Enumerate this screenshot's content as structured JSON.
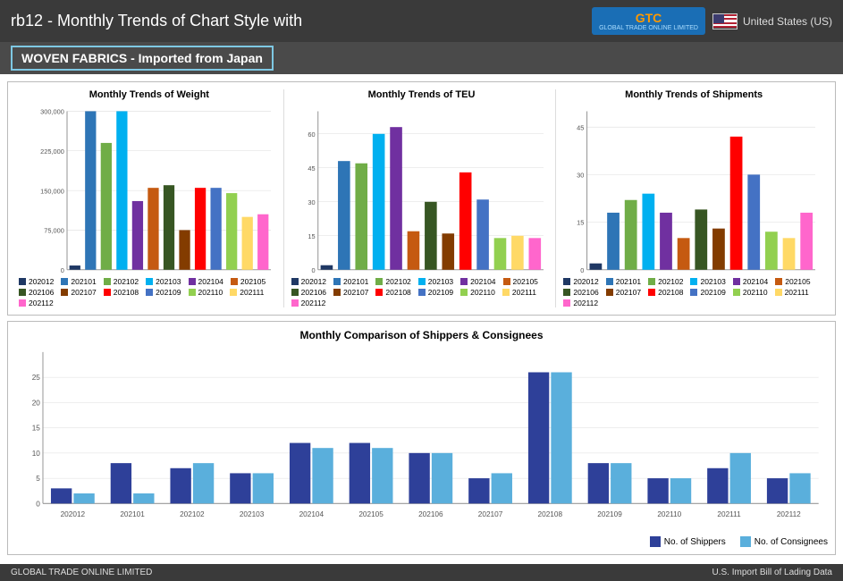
{
  "header": {
    "title": "rb12 - Monthly Trends of Chart Style with",
    "subtitle": "WOVEN FABRICS - Imported from Japan",
    "country": "United States (US)"
  },
  "footer": {
    "left": "GLOBAL TRADE ONLINE LIMITED",
    "right": "U.S. Import Bill of Lading Data"
  },
  "legends": {
    "periods": [
      {
        "id": "202012",
        "color": "#1f3864"
      },
      {
        "id": "202101",
        "color": "#2e75b6"
      },
      {
        "id": "202102",
        "color": "#70ad47"
      },
      {
        "id": "202103",
        "color": "#00b0f0"
      },
      {
        "id": "202104",
        "color": "#7030a0"
      },
      {
        "id": "202105",
        "color": "#c55a11"
      },
      {
        "id": "202106",
        "color": "#375623"
      },
      {
        "id": "202107",
        "color": "#833c00"
      },
      {
        "id": "202108",
        "color": "#ff0000"
      },
      {
        "id": "202109",
        "color": "#4472c4"
      },
      {
        "id": "202110",
        "color": "#92d050"
      },
      {
        "id": "202111",
        "color": "#ffd966"
      },
      {
        "id": "202112",
        "color": "#ff66cc"
      }
    ]
  },
  "weightChart": {
    "title": "Monthly Trends of Weight",
    "yLabels": [
      "300,000",
      "225,000",
      "150,000",
      "75,000",
      "0"
    ],
    "bars": [
      {
        "period": "202012",
        "value": 8000,
        "color": "#1f3864"
      },
      {
        "period": "202101",
        "value": 320000,
        "color": "#2e75b6"
      },
      {
        "period": "202102",
        "value": 240000,
        "color": "#70ad47"
      },
      {
        "period": "202103",
        "value": 320000,
        "color": "#00b0f0"
      },
      {
        "period": "202104",
        "value": 130000,
        "color": "#7030a0"
      },
      {
        "period": "202105",
        "value": 155000,
        "color": "#c55a11"
      },
      {
        "period": "202106",
        "value": 160000,
        "color": "#375623"
      },
      {
        "period": "202107",
        "value": 75000,
        "color": "#833c00"
      },
      {
        "period": "202108",
        "value": 155000,
        "color": "#ff0000"
      },
      {
        "period": "202109",
        "value": 155000,
        "color": "#4472c4"
      },
      {
        "period": "202110",
        "value": 145000,
        "color": "#92d050"
      },
      {
        "period": "202111",
        "value": 100000,
        "color": "#ffd966"
      },
      {
        "period": "202112",
        "value": 105000,
        "color": "#ff66cc"
      }
    ],
    "maxVal": 340000
  },
  "teuChart": {
    "title": "Monthly Trends of TEU",
    "yLabels": [
      "60",
      "45",
      "30",
      "15",
      "0"
    ],
    "bars": [
      {
        "period": "202012",
        "value": 2,
        "color": "#1f3864"
      },
      {
        "period": "202101",
        "value": 48,
        "color": "#2e75b6"
      },
      {
        "period": "202102",
        "value": 47,
        "color": "#70ad47"
      },
      {
        "period": "202103",
        "value": 60,
        "color": "#00b0f0"
      },
      {
        "period": "202104",
        "value": 63,
        "color": "#7030a0"
      },
      {
        "period": "202105",
        "value": 17,
        "color": "#c55a11"
      },
      {
        "period": "202106",
        "value": 30,
        "color": "#375623"
      },
      {
        "period": "202107",
        "value": 16,
        "color": "#833c00"
      },
      {
        "period": "202108",
        "value": 43,
        "color": "#ff0000"
      },
      {
        "period": "202109",
        "value": 31,
        "color": "#4472c4"
      },
      {
        "period": "202110",
        "value": 14,
        "color": "#92d050"
      },
      {
        "period": "202111",
        "value": 15,
        "color": "#ffd966"
      },
      {
        "period": "202112",
        "value": 14,
        "color": "#ff66cc"
      }
    ],
    "maxVal": 70
  },
  "shipmentsChart": {
    "title": "Monthly Trends of Shipments",
    "yLabels": [
      "45",
      "30",
      "15",
      "0"
    ],
    "bars": [
      {
        "period": "202012",
        "value": 2,
        "color": "#1f3864"
      },
      {
        "period": "202101",
        "value": 18,
        "color": "#2e75b6"
      },
      {
        "period": "202102",
        "value": 22,
        "color": "#70ad47"
      },
      {
        "period": "202103",
        "value": 24,
        "color": "#00b0f0"
      },
      {
        "period": "202104",
        "value": 18,
        "color": "#7030a0"
      },
      {
        "period": "202105",
        "value": 10,
        "color": "#c55a11"
      },
      {
        "period": "202106",
        "value": 19,
        "color": "#375623"
      },
      {
        "period": "202107",
        "value": 13,
        "color": "#833c00"
      },
      {
        "period": "202108",
        "value": 42,
        "color": "#ff0000"
      },
      {
        "period": "202109",
        "value": 30,
        "color": "#4472c4"
      },
      {
        "period": "202110",
        "value": 12,
        "color": "#92d050"
      },
      {
        "period": "202111",
        "value": 10,
        "color": "#ffd966"
      },
      {
        "period": "202112",
        "value": 18,
        "color": "#ff66cc"
      }
    ],
    "maxVal": 50
  },
  "bottomChart": {
    "title": "Monthly Comparison of Shippers & Consignees",
    "months": [
      "202012",
      "202101",
      "202102",
      "202103",
      "202104",
      "202105",
      "202106",
      "202107",
      "202108",
      "202109",
      "202110",
      "202111",
      "202112"
    ],
    "shippers": [
      3,
      8,
      7,
      6,
      12,
      12,
      10,
      5,
      26,
      8,
      5,
      7,
      5
    ],
    "consignees": [
      2,
      2,
      8,
      6,
      11,
      11,
      10,
      6,
      26,
      8,
      5,
      10,
      6
    ],
    "maxVal": 30,
    "shipperColor": "#2e4099",
    "consigneeColor": "#5aafdc",
    "legend": {
      "shippers": "No. of Shippers",
      "consignees": "No. of Consignees"
    }
  }
}
